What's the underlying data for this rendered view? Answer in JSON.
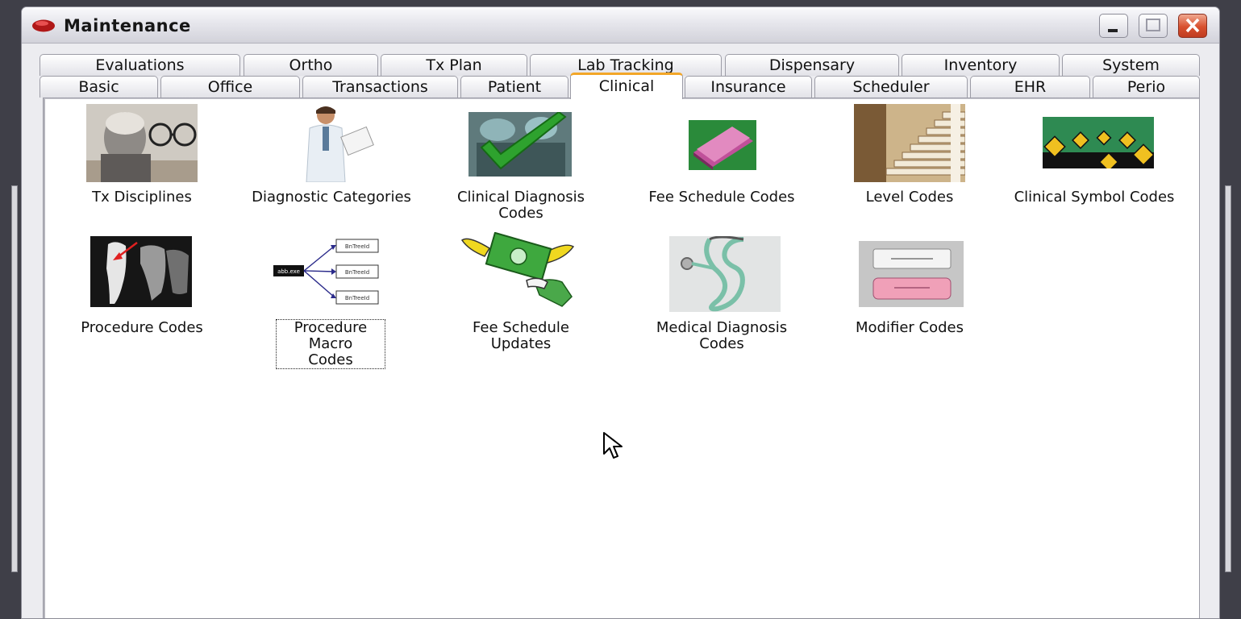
{
  "window": {
    "title": "Maintenance",
    "controls": {
      "minimize": "minimize",
      "maximize": "maximize",
      "close": "close"
    }
  },
  "tabs": {
    "back_row": [
      "Evaluations",
      "Ortho",
      "Tx Plan",
      "Lab Tracking",
      "Dispensary",
      "Inventory",
      "System"
    ],
    "front_row": [
      "Basic",
      "Office",
      "Transactions",
      "Patient",
      "Clinical",
      "Insurance",
      "Scheduler",
      "EHR",
      "Perio"
    ],
    "active": "Clinical"
  },
  "items": [
    {
      "label": "Tx Disciplines",
      "icon": "man-with-glasses-photo-icon"
    },
    {
      "label": "Diagnostic Categories",
      "icon": "doctor-with-clipboard-icon"
    },
    {
      "label": "Clinical Diagnosis\nCodes",
      "icon": "surgery-checkmark-icon"
    },
    {
      "label": "Fee Schedule Codes",
      "icon": "pink-book-icon"
    },
    {
      "label": "Level Codes",
      "icon": "staircase-photo-icon"
    },
    {
      "label": "Clinical Symbol Codes",
      "icon": "road-signs-icon"
    },
    {
      "label": "Procedure Codes",
      "icon": "dental-xray-icon"
    },
    {
      "label": "Procedure Macro\nCodes",
      "icon": "macro-tree-diagram-icon",
      "focused": true
    },
    {
      "label": "Fee Schedule\nUpdates",
      "icon": "flying-money-icon"
    },
    {
      "label": "Medical Diagnosis\nCodes",
      "icon": "stethoscope-icon"
    },
    {
      "label": "Modifier Codes",
      "icon": "eraser-icon"
    }
  ],
  "diagram_labels": {
    "root": "abb.exe",
    "child": "BnTreeId"
  }
}
